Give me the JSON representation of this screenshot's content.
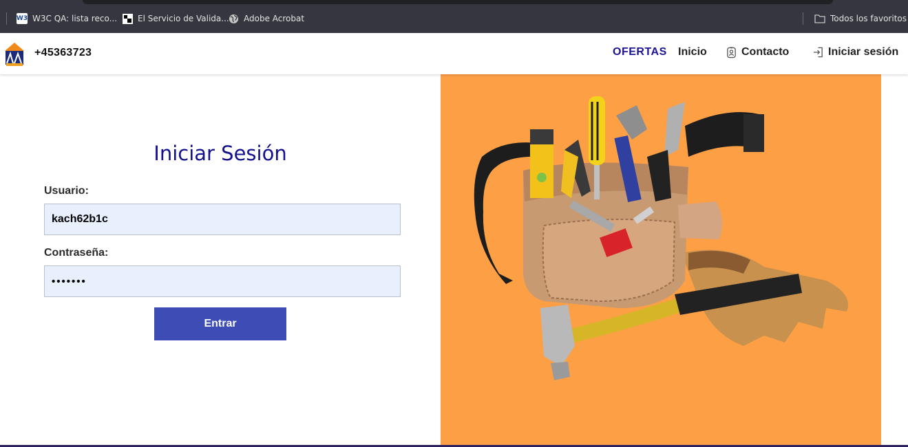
{
  "browser": {
    "bookmarks": [
      {
        "label": "W3C QA: lista reco...",
        "icon": "w3c-icon"
      },
      {
        "label": "El Servicio de Valida...",
        "icon": "validator-icon"
      },
      {
        "label": "Adobe Acrobat",
        "icon": "globe-icon"
      }
    ],
    "all_bookmarks_label": "Todos los favoritos",
    "w3c_icon_text": "W3"
  },
  "header": {
    "phone": "+45363723",
    "nav": {
      "ofertas": "OFERTAS",
      "inicio": "Inicio",
      "contacto": "Contacto",
      "login": "Iniciar sesión"
    }
  },
  "login": {
    "title": "Iniciar Sesión",
    "username_label": "Usuario:",
    "username_value": "kach62b1c",
    "password_label": "Contraseña:",
    "password_value": "•••••••",
    "submit_label": "Entrar"
  },
  "colors": {
    "accent": "#1b1496",
    "button": "#3d4db5",
    "hero_bg": "#fd9f45",
    "input_bg": "#e8f0fd"
  }
}
